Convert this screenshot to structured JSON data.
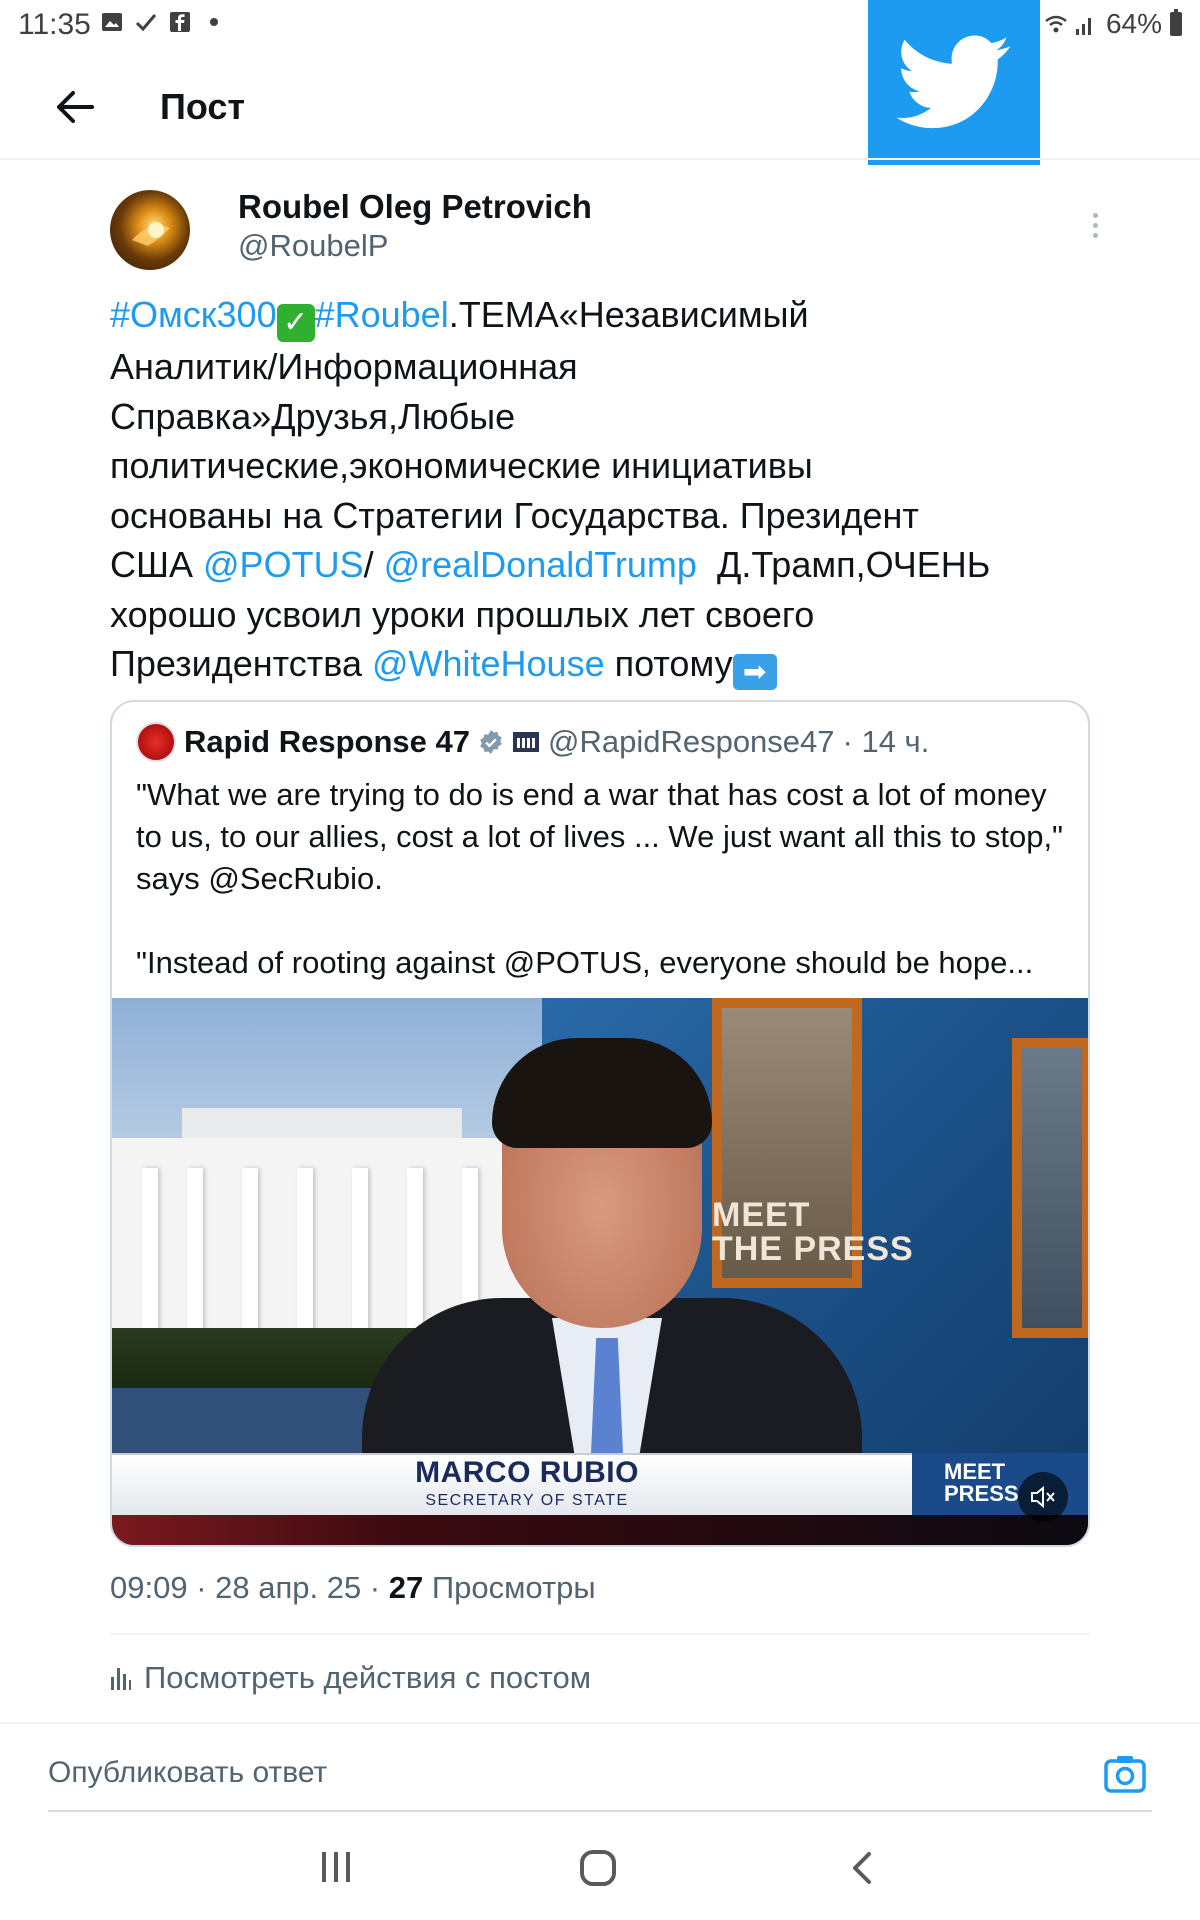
{
  "status_bar": {
    "time": "11:35",
    "battery": "64%"
  },
  "header": {
    "title": "Пост"
  },
  "post": {
    "author_name": "Roubel Oleg Petrovich",
    "author_handle": "@RoubelP",
    "text": {
      "hashtag1": "#Омск300",
      "check_emoji": "✓",
      "hashtag2": "#Roubel",
      "line1_rest": ".ТЕМА«Независимый",
      "line2": "Аналитик/Информационная",
      "line3": "Справка»Друзья,Любые",
      "line4": "политические,экономические инициативы",
      "line5": "основаны на Стратегии Государства. Президент",
      "line6_start": "США ",
      "mention_potus": "@POTUS",
      "slash": "/ ",
      "mention_trump": "@realDonaldTrump",
      "line6_end": "  Д.Трамп,ОЧЕНЬ",
      "line7": "хорошо усвоил уроки прошлых лет своего",
      "line8_start": "Президентства ",
      "mention_whitehouse": "@WhiteHouse",
      "line8_end": " потому",
      "arrow_emoji": "➡"
    },
    "quote": {
      "name": "Rapid Response 47",
      "handle": "@RapidResponse47",
      "time": "· 14 ч.",
      "text": "\"What we are trying to do is end a war that has cost a lot of money to us, to our allies, cost a lot of lives ... We just want all this to stop,\" says @SecRubio.\n\n\"Instead of rooting against @POTUS, everyone should be hope...",
      "media": {
        "lower_third_name": "MARCO RUBIO",
        "lower_third_role": "SECRETARY OF STATE",
        "show_logo_line1": "MEET",
        "show_logo_line2": "THE PRESS",
        "corner_logo_line1": "MEET",
        "corner_logo_line2": "PRESS"
      }
    },
    "meta_time": "09:09 · 28 апр. 25 · ",
    "meta_views_count": "27",
    "meta_views_label": " Просмотры",
    "activity_label": "Посмотреть действия с постом"
  },
  "reply": {
    "placeholder": "Опубликовать ответ"
  },
  "colors": {
    "accent": "#1d9bf0",
    "text": "#0f1419",
    "secondary": "#536471"
  },
  "icons": [
    "back-arrow-icon",
    "twitter-bird-icon",
    "more-icon",
    "verified-icon",
    "gov-building-icon",
    "mute-icon",
    "analytics-icon",
    "camera-icon"
  ]
}
